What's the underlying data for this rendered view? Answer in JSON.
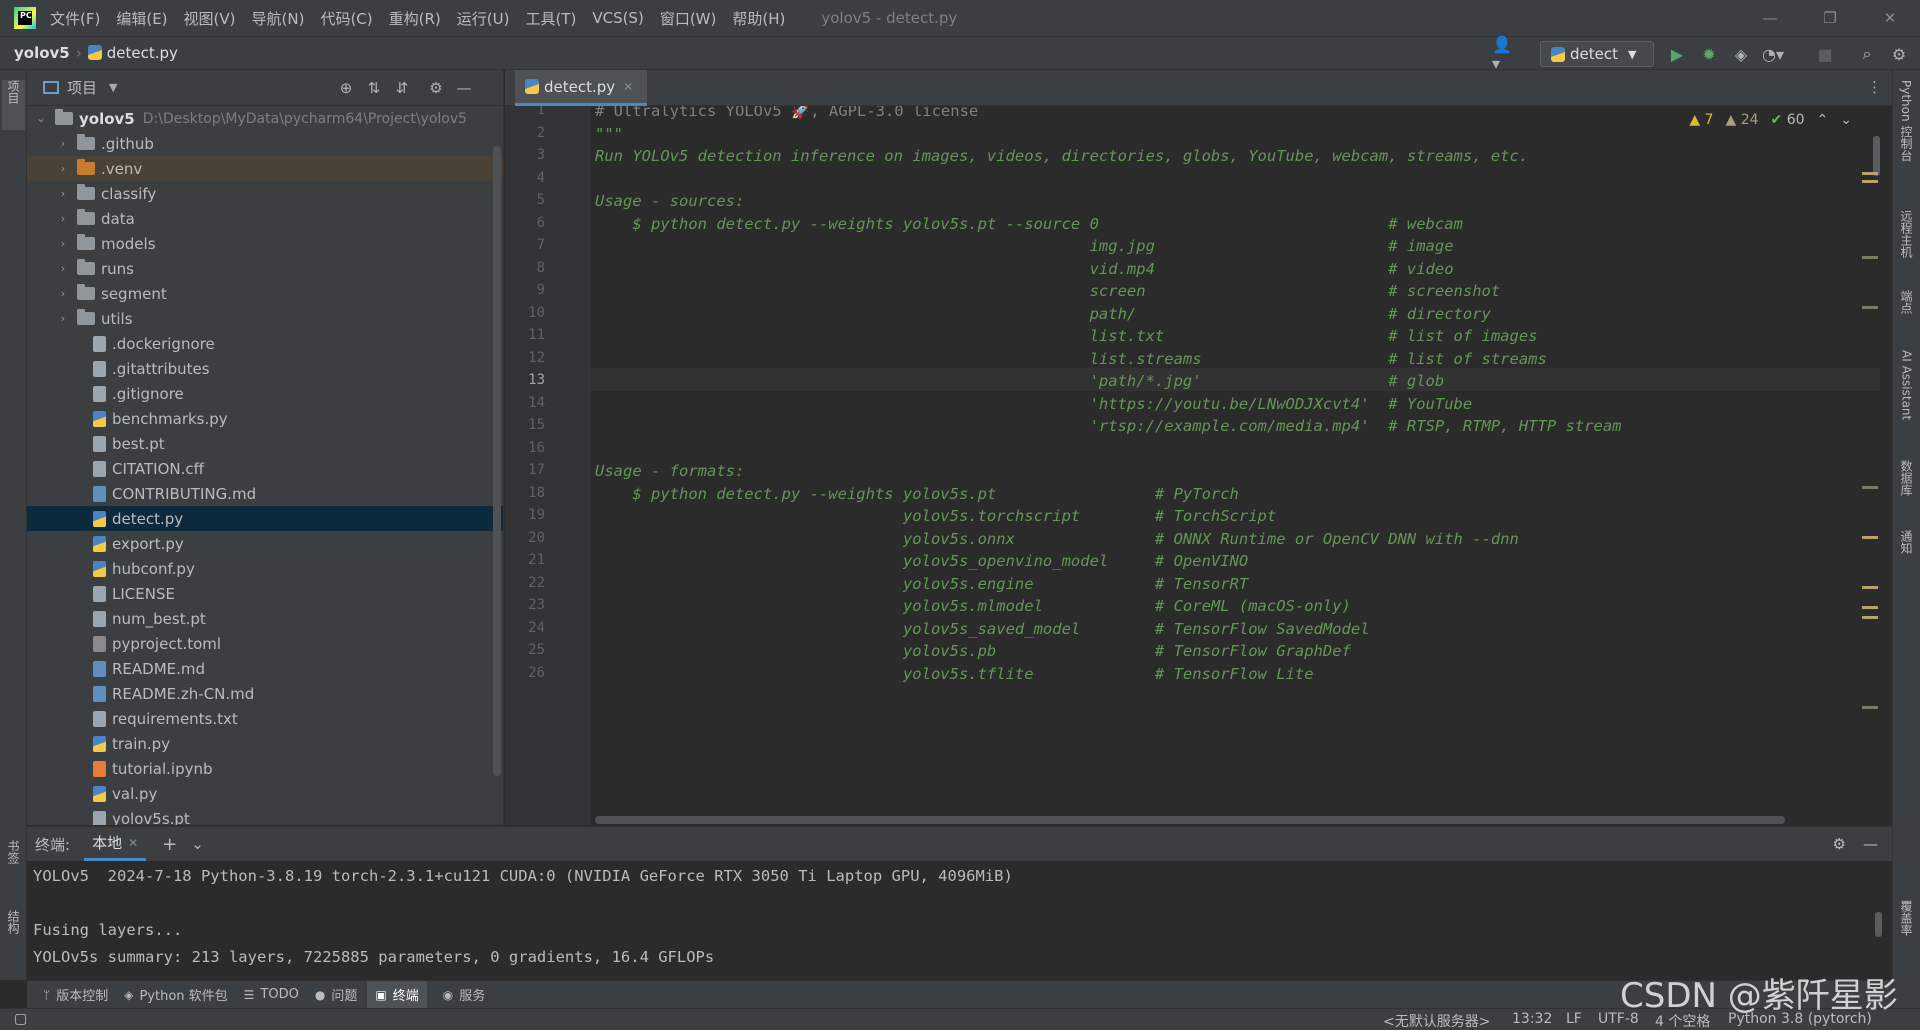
{
  "titlebar": {
    "menus": [
      "文件(F)",
      "编辑(E)",
      "视图(V)",
      "导航(N)",
      "代码(C)",
      "重构(R)",
      "运行(U)",
      "工具(T)",
      "VCS(S)",
      "窗口(W)",
      "帮助(H)"
    ],
    "window_title": "yolov5 - detect.py"
  },
  "navbar": {
    "project": "yolov5",
    "file": "detect.py",
    "run_config": "detect"
  },
  "left_strip": {
    "project_tab": "项目",
    "bookmarks_tab": "书签",
    "structure_tab": "结构"
  },
  "right_strip": {
    "python_console": "Python 控制台",
    "remote_host": "远程主机",
    "endpoints": "端点",
    "ai_assistant": "AI Assistant",
    "database": "数据库",
    "notifications": "通知",
    "coverage": "覆盖率"
  },
  "project_panel": {
    "title": "项目",
    "root_name": "yolov5",
    "root_path": "D:\\Desktop\\MyData\\pycharm64\\Project\\yolov5",
    "folders": [
      ".github",
      ".venv",
      "classify",
      "data",
      "models",
      "runs",
      "segment",
      "utils"
    ],
    "files": [
      ".dockerignore",
      ".gitattributes",
      ".gitignore",
      "benchmarks.py",
      "best.pt",
      "CITATION.cff",
      "CONTRIBUTING.md",
      "detect.py",
      "export.py",
      "hubconf.py",
      "LICENSE",
      "num_best.pt",
      "pyproject.toml",
      "README.md",
      "README.zh-CN.md",
      "requirements.txt",
      "train.py",
      "tutorial.ipynb",
      "val.py",
      "yolov5s.pt"
    ]
  },
  "editor": {
    "tab": "detect.py",
    "inspections": {
      "warnings": "7",
      "weak_warnings": "24",
      "ok": "60"
    },
    "line_numbers": [
      "1",
      "2",
      "3",
      "4",
      "5",
      "6",
      "7",
      "8",
      "9",
      "10",
      "11",
      "12",
      "13",
      "14",
      "15",
      "16",
      "17",
      "18",
      "19",
      "20",
      "21",
      "22",
      "23",
      "24",
      "25",
      "26"
    ],
    "current_line": "13",
    "lines": [
      "# Ultralytics YOLOv5 🚀, AGPL-3.0 license",
      "\"\"\"",
      "Run YOLOv5 detection inference on images, videos, directories, globs, YouTube, webcam, streams, etc.",
      "",
      "Usage - sources:",
      "    $ python detect.py --weights yolov5s.pt --source 0                               # webcam",
      "                                                     img.jpg                         # image",
      "                                                     vid.mp4                         # video",
      "                                                     screen                          # screenshot",
      "                                                     path/                           # directory",
      "                                                     list.txt                        # list of images",
      "                                                     list.streams                    # list of streams",
      "                                                     'path/*.jpg'                    # glob",
      "                                                     'https://youtu.be/LNwODJXcvt4'  # YouTube",
      "                                                     'rtsp://example.com/media.mp4'  # RTSP, RTMP, HTTP stream",
      "",
      "Usage - formats:",
      "    $ python detect.py --weights yolov5s.pt                 # PyTorch",
      "                                 yolov5s.torchscript        # TorchScript",
      "                                 yolov5s.onnx               # ONNX Runtime or OpenCV DNN with --dnn",
      "                                 yolov5s_openvino_model     # OpenVINO",
      "                                 yolov5s.engine             # TensorRT",
      "                                 yolov5s.mlmodel            # CoreML (macOS-only)",
      "                                 yolov5s_saved_model        # TensorFlow SavedModel",
      "                                 yolov5s.pb                 # TensorFlow GraphDef",
      "                                 yolov5s.tflite             # TensorFlow Lite"
    ]
  },
  "terminal": {
    "label": "终端:",
    "tab": "本地",
    "lines": [
      "YOLOv5  2024-7-18 Python-3.8.19 torch-2.3.1+cu121 CUDA:0 (NVIDIA GeForce RTX 3050 Ti Laptop GPU, 4096MiB)",
      "",
      "Fusing layers...",
      "YOLOv5s summary: 213 layers, 7225885 parameters, 0 gradients, 16.4 GFLOPs"
    ]
  },
  "tool_tabs": [
    "版本控制",
    "Python 软件包",
    "TODO",
    "问题",
    "终端",
    "服务"
  ],
  "statusbar": {
    "server": "<无默认服务器>",
    "position": "13:32",
    "line_sep": "LF",
    "encoding": "UTF-8",
    "indent": "4 个空格",
    "interpreter": "Python 3.8 (pytorch)"
  },
  "watermark": "CSDN @紫阡星影"
}
